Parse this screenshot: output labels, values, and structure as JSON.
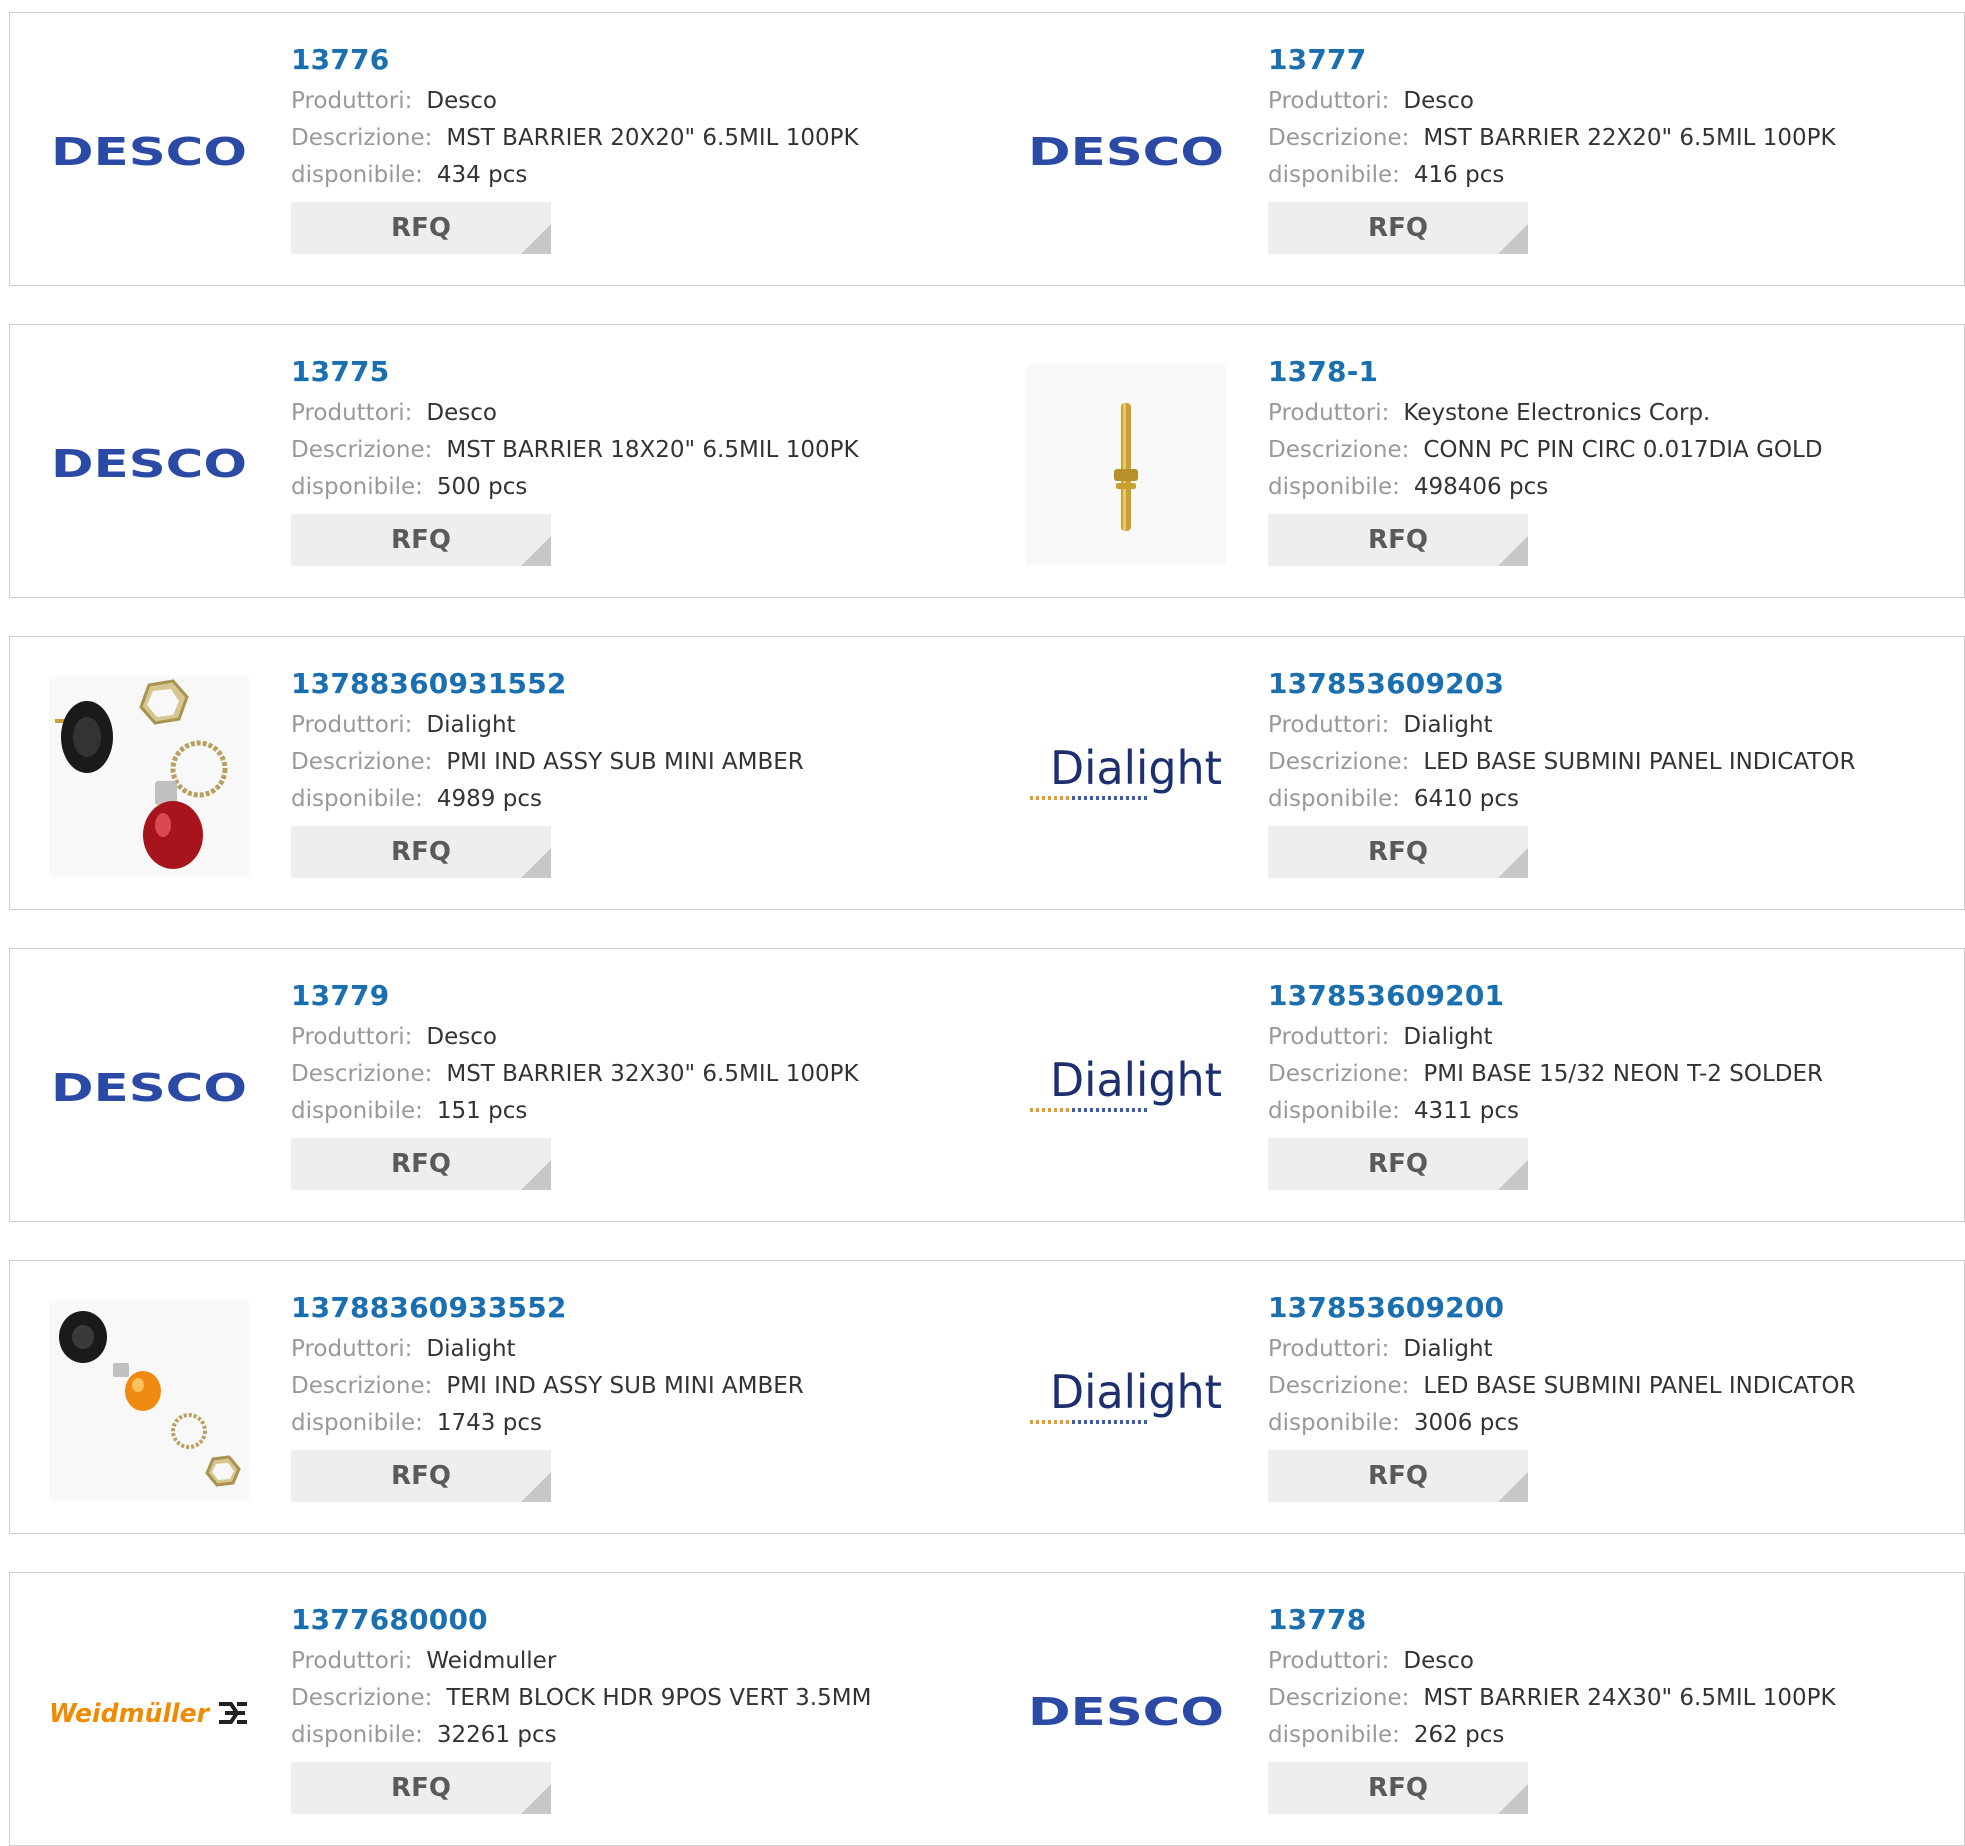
{
  "labels": {
    "manufacturer": "Produttori:",
    "description": "Descrizione:",
    "available": "disponibile:",
    "rfq": "RFQ"
  },
  "products": [
    {
      "part_number": "13776",
      "manufacturer": "Desco",
      "description": "MST BARRIER 20X20\" 6.5MIL 100PK",
      "available": "434 pcs",
      "image": "desco-logo"
    },
    {
      "part_number": "13777",
      "manufacturer": "Desco",
      "description": "MST BARRIER 22X20\" 6.5MIL 100PK",
      "available": "416 pcs",
      "image": "desco-logo"
    },
    {
      "part_number": "13775",
      "manufacturer": "Desco",
      "description": "MST BARRIER 18X20\" 6.5MIL 100PK",
      "available": "500 pcs",
      "image": "desco-logo"
    },
    {
      "part_number": "1378-1",
      "manufacturer": "Keystone Electronics Corp.",
      "description": "CONN PC PIN CIRC 0.017DIA GOLD",
      "available": "498406 pcs",
      "image": "pin-photo"
    },
    {
      "part_number": "13788360931552",
      "manufacturer": "Dialight",
      "description": "PMI IND ASSY SUB MINI AMBER",
      "available": "4989 pcs",
      "image": "red-lamp-photo"
    },
    {
      "part_number": "137853609203",
      "manufacturer": "Dialight",
      "description": "LED BASE SUBMINI PANEL INDICATOR",
      "available": "6410 pcs",
      "image": "dialight-logo"
    },
    {
      "part_number": "13779",
      "manufacturer": "Desco",
      "description": "MST BARRIER 32X30\" 6.5MIL 100PK",
      "available": "151 pcs",
      "image": "desco-logo"
    },
    {
      "part_number": "137853609201",
      "manufacturer": "Dialight",
      "description": "PMI BASE 15/32 NEON T-2 SOLDER",
      "available": "4311 pcs",
      "image": "dialight-logo"
    },
    {
      "part_number": "13788360933552",
      "manufacturer": "Dialight",
      "description": "PMI IND ASSY SUB MINI AMBER",
      "available": "1743 pcs",
      "image": "amber-lamp-photo"
    },
    {
      "part_number": "137853609200",
      "manufacturer": "Dialight",
      "description": "LED BASE SUBMINI PANEL INDICATOR",
      "available": "3006 pcs",
      "image": "dialight-logo"
    },
    {
      "part_number": "1377680000",
      "manufacturer": "Weidmuller",
      "description": "TERM BLOCK HDR 9POS VERT 3.5MM",
      "available": "32261 pcs",
      "image": "weidmuller-logo"
    },
    {
      "part_number": "13778",
      "manufacturer": "Desco",
      "description": "MST BARRIER 24X30\" 6.5MIL 100PK",
      "available": "262 pcs",
      "image": "desco-logo"
    }
  ],
  "logos": {
    "desco": "DESCO",
    "dialight": "Dialight",
    "weidmuller": "Weidmüller"
  },
  "colors": {
    "part_number": "#1a6fb0",
    "label": "#999999",
    "value": "#333333",
    "button_bg": "#eeeeee",
    "desco_blue": "#2b4aa6",
    "dialight_navy": "#1d2f6e",
    "weidmuller_orange": "#f08a00"
  }
}
